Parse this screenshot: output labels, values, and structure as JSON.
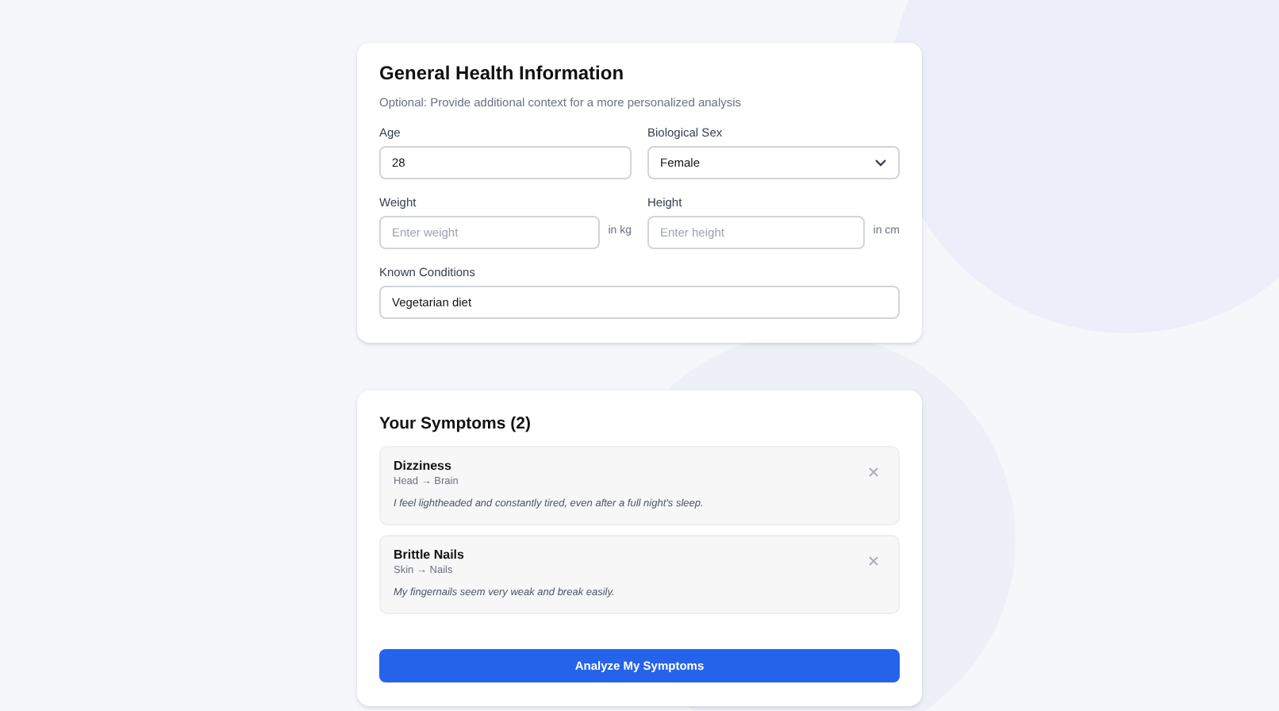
{
  "general": {
    "title": "General Health Information",
    "subtitle": "Optional: Provide additional context for a more personalized analysis",
    "rows": [
      [
        {
          "kind": "input",
          "label": "Age",
          "value": "28"
        },
        {
          "kind": "select",
          "label": "Biological Sex",
          "value": "Female"
        }
      ],
      [
        {
          "kind": "input",
          "label": "Weight",
          "placeholder": "Enter weight",
          "unit": "in kg"
        },
        {
          "kind": "input",
          "label": "Height",
          "placeholder": "Enter height",
          "unit": "in cm"
        }
      ],
      [
        {
          "kind": "input",
          "label": "Known Conditions",
          "value": "Vegetarian diet"
        }
      ]
    ]
  },
  "symptoms": {
    "title": "Your Symptoms (2)",
    "items": [
      {
        "name": "Dizziness",
        "path": "Head → Brain",
        "note": "I feel lightheaded and constantly tired, even after a full night's sleep."
      },
      {
        "name": "Brittle Nails",
        "path": "Skin → Nails",
        "note": "My fingernails seem very weak and break easily."
      }
    ],
    "button": "Analyze My Symptoms"
  }
}
